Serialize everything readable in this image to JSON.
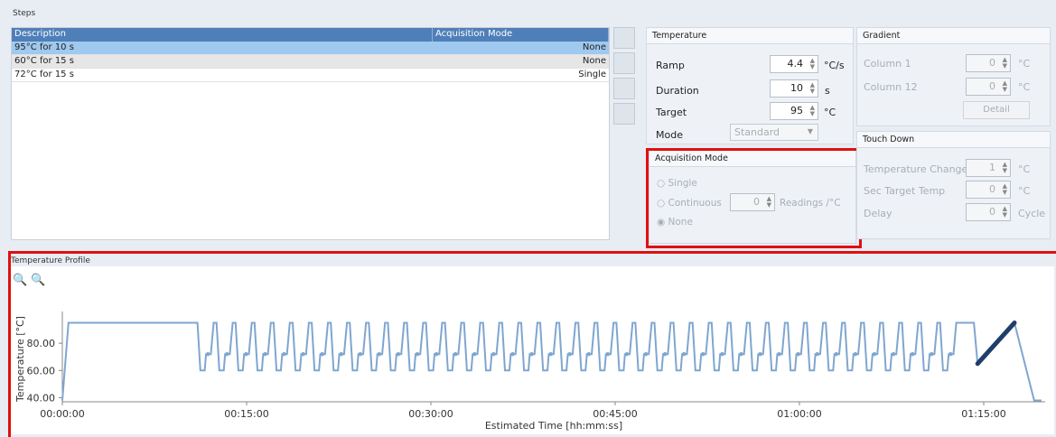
{
  "steps": {
    "title": "Steps",
    "columns": [
      "Description",
      "Acquisition Mode"
    ],
    "rows": [
      {
        "description": "95°C for 10 s",
        "acq": "None"
      },
      {
        "description": "60°C for 15 s",
        "acq": "None"
      },
      {
        "description": "72°C for 15 s",
        "acq": "Single"
      }
    ]
  },
  "temperature": {
    "title": "Temperature",
    "ramp_label": "Ramp",
    "ramp_value": "4.4",
    "ramp_unit": "°C/s",
    "duration_label": "Duration",
    "duration_value": "10",
    "duration_unit": "s",
    "target_label": "Target",
    "target_value": "95",
    "target_unit": "°C",
    "mode_label": "Mode",
    "mode_value": "Standard"
  },
  "acquisition": {
    "title": "Acquisition Mode",
    "single": "Single",
    "continuous": "Continuous",
    "continuous_value": "0",
    "readings_unit": "Readings /°C",
    "none": "None",
    "selected": "None"
  },
  "gradient": {
    "title": "Gradient",
    "col1_label": "Column 1",
    "col1_value": "0",
    "col1_unit": "°C",
    "col12_label": "Column 12",
    "col12_value": "0",
    "col12_unit": "°C",
    "detail_label": "Detail"
  },
  "touchdown": {
    "title": "Touch Down",
    "temp_change_label": "Temperature Change",
    "temp_change_value": "1",
    "temp_change_unit": "°C",
    "sec_target_label": "Sec Target Temp",
    "sec_target_value": "0",
    "sec_target_unit": "°C",
    "delay_label": "Delay",
    "delay_value": "0",
    "delay_unit": "Cycle"
  },
  "profile": {
    "title": "Temperature Profile"
  },
  "colors": {
    "accent": "#4f7fb8",
    "selected_row": "#9fc9ee",
    "highlight": "#e01010",
    "line": "#7fa6cf",
    "dark_line": "#1f3f6a"
  },
  "chart_data": {
    "type": "line",
    "xlabel": "Estimated Time [hh:mm:ss]",
    "ylabel": "Temperature [°C]",
    "x_ticks": [
      "00:00:00",
      "00:15:00",
      "00:30:00",
      "00:45:00",
      "01:00:00",
      "01:15:00"
    ],
    "y_ticks": [
      "40.00",
      "60.00",
      "80.00"
    ],
    "xlim_minutes": [
      0,
      80
    ],
    "ylim": [
      37,
      100
    ],
    "initial_denaturation": {
      "start_min": 0.5,
      "end_min": 11,
      "temp": 95
    },
    "cycles": 40,
    "cycle_temps": [
      95,
      60,
      72
    ],
    "cycles_end_min": 73,
    "melt": {
      "start_min": 74.5,
      "end_min": 77.5,
      "from": 65,
      "to": 95
    },
    "end_temp": 38
  }
}
